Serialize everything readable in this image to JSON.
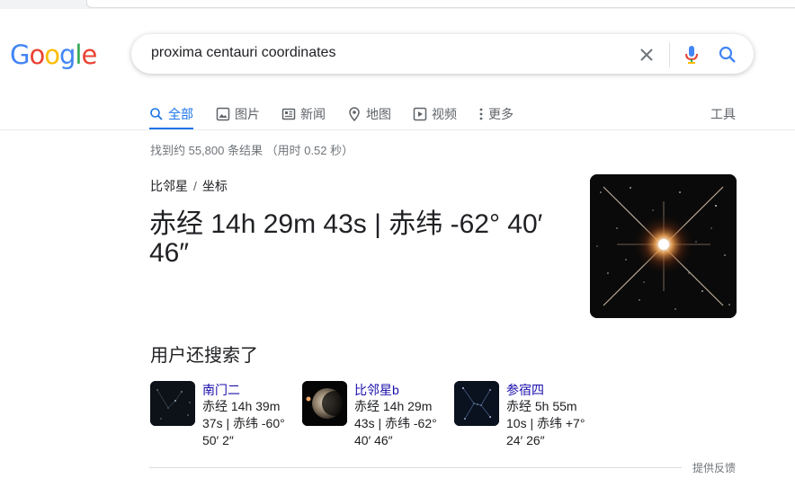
{
  "logo": {
    "letters": [
      "G",
      "o",
      "o",
      "g",
      "l",
      "e"
    ],
    "colors": [
      "#4285f4",
      "#ea4335",
      "#fbbc05",
      "#4285f4",
      "#34a853",
      "#ea4335"
    ]
  },
  "search": {
    "query": "proxima centauri coordinates",
    "clear_icon": "close-icon",
    "voice_icon": "mic-icon",
    "search_icon": "search-icon"
  },
  "tabs": [
    {
      "label": "全部",
      "icon": "search-icon",
      "active": true
    },
    {
      "label": "图片",
      "icon": "image-icon"
    },
    {
      "label": "新闻",
      "icon": "news-icon"
    },
    {
      "label": "地图",
      "icon": "map-pin-icon"
    },
    {
      "label": "视频",
      "icon": "video-icon"
    },
    {
      "label": "更多",
      "icon": "more-vert-icon"
    }
  ],
  "tools_label": "工具",
  "result_stats": "找到约 55,800 条结果  （用时 0.52 秒）",
  "breadcrumb": {
    "parent": "比邻星",
    "separator": "/",
    "current": "坐标"
  },
  "answer": "赤经 14h 29m 43s | 赤纬 -62° 40′ 46″",
  "people_also_search": {
    "title": "用户还搜索了",
    "items": [
      {
        "name": "南门二",
        "desc": "赤经 14h 39m 37s | 赤纬 -60° 50′ 2″"
      },
      {
        "name": "比邻星b",
        "desc": "赤经 14h 29m 43s | 赤纬 -62° 40′ 46″"
      },
      {
        "name": "参宿四",
        "desc": "赤经 5h 55m 10s | 赤纬 +7° 24′ 26″"
      }
    ]
  },
  "feedback_label": "提供反馈",
  "colors": {
    "accent": "#1a73e8",
    "link": "#1a0dab",
    "text": "#202124",
    "muted": "#70757a"
  }
}
